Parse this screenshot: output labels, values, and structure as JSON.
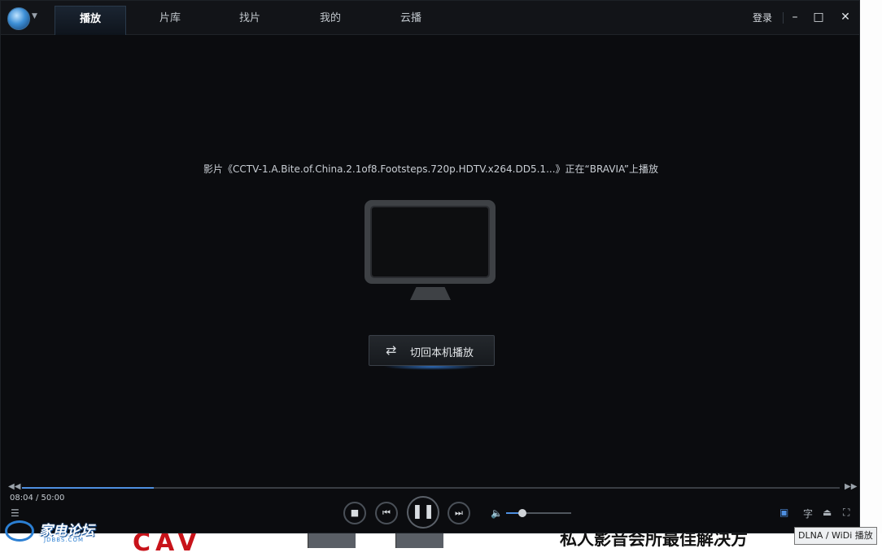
{
  "app": {
    "tabs": [
      "播放",
      "片库",
      "找片",
      "我的",
      "云播"
    ],
    "active_tab": "播放",
    "login_label": "登录",
    "window_controls": {
      "minimize": "–",
      "maximize": "□",
      "close": "✕"
    }
  },
  "main": {
    "now_playing_text": "影片《CCTV-1.A.Bite.of.China.2.1of8.Footsteps.720p.HDTV.x264.DD5.1...》正在“BRAVIA”上播放",
    "device_icon": "tv-icon",
    "switch_button_label": "切回本机播放",
    "switch_button_icon": "switch-arrows-icon"
  },
  "controls": {
    "time_text": "08:04 / 50:00",
    "progress": 0.161,
    "volume": 0.25,
    "buttons": [
      "stop-icon",
      "previous-icon",
      "pause-icon",
      "next-icon"
    ],
    "right_icons": [
      "dlna-cast-icon",
      "subtitle-icon",
      "eject-icon",
      "fullscreen-icon"
    ],
    "subtitle_glyph": "字",
    "tooltip": "DLNA / WiDi 播放"
  },
  "background": {
    "banner_text": "CAV",
    "headline_text": "私人影音会所最佳解决方",
    "forum_name": "家电论坛",
    "forum_url": "JDBBS.COM"
  },
  "colors": {
    "accent": "#4e8fe0",
    "player_bg": "#0b0c0f",
    "brand_red": "#c8131a"
  }
}
